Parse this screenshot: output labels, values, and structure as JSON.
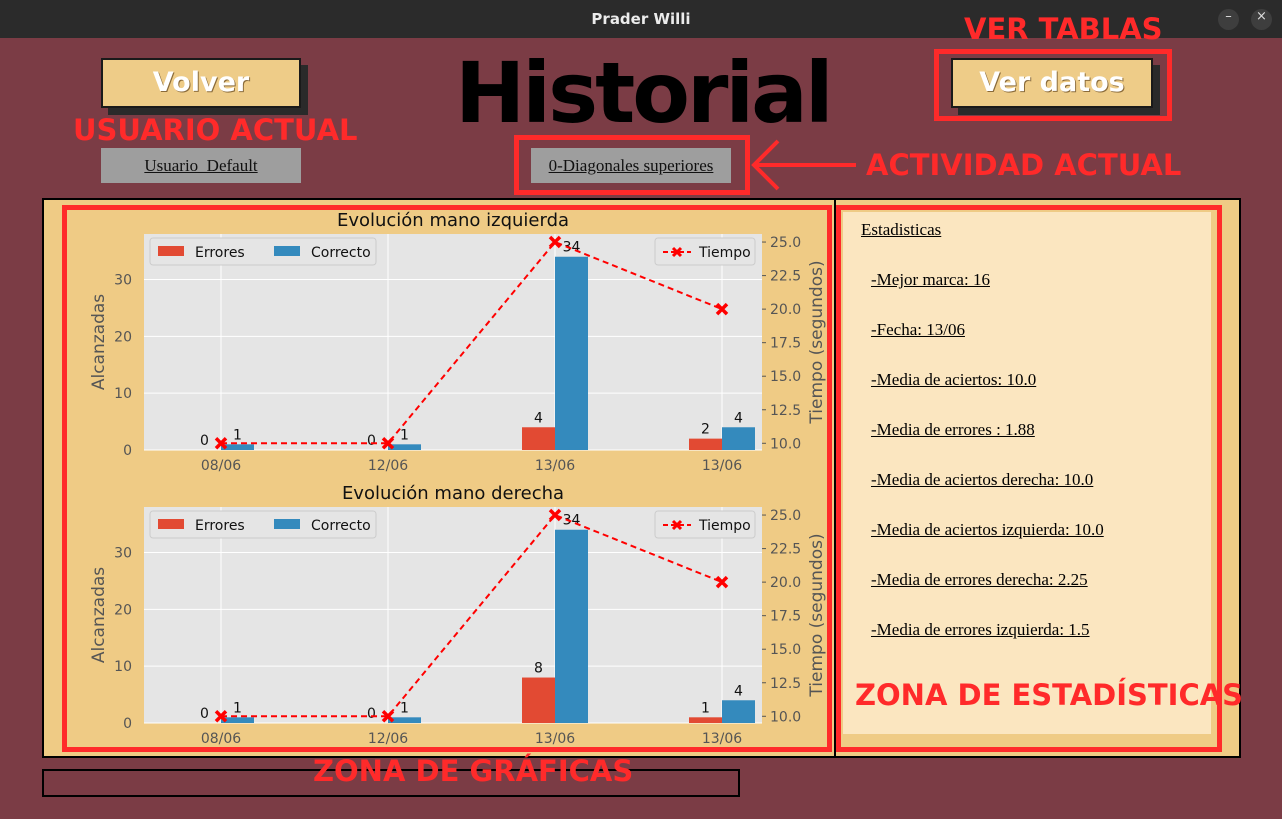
{
  "window": {
    "title": "Prader Willi"
  },
  "header": {
    "back_button": "Volver",
    "title": "Historial",
    "view_data_button": "Ver datos",
    "user": "Usuario_Default",
    "activity": "0-Diagonales superiores"
  },
  "annotations": {
    "ver_tablas": "VER TABLAS",
    "usuario_actual": "USUARIO ACTUAL",
    "actividad_actual": "ACTIVIDAD ACTUAL",
    "zona_graficas": "ZONA DE GRÁFICAS",
    "zona_estadisticas": "ZONA DE ESTADÍSTICAS"
  },
  "stats": {
    "title": "Estadisticas",
    "lines": [
      "-Mejor marca:  16",
      "-Fecha:  13/06",
      "-Media de aciertos:  10.0",
      "-Media de errores :  1.88",
      "-Media de aciertos derecha:  10.0",
      "-Media de aciertos izquierda:  10.0",
      "-Media de errores derecha:  2.25",
      "-Media de errores izquierda:  1.5"
    ]
  },
  "colors": {
    "background": "#7b3c45",
    "panel": "#efcb85",
    "stats_panel": "#fbe6c0",
    "button": "#eecc88",
    "annotation": "#ff2a2a",
    "errores": "#e24a33",
    "correcto": "#348abd",
    "tiempo": "#ff0000"
  },
  "chart_data": [
    {
      "type": "bar",
      "title": "Evolución mano izquierda",
      "categories": [
        "08/06",
        "12/06",
        "13/06",
        "13/06"
      ],
      "ylabel": "Alcanzadas",
      "y2label": "Tiempo (segundos)",
      "ylim": [
        0,
        38
      ],
      "y2lim": [
        9.5,
        25.6
      ],
      "yticks": [
        0,
        10,
        20,
        30
      ],
      "y2ticks": [
        10.0,
        12.5,
        15.0,
        17.5,
        20.0,
        22.5,
        25.0
      ],
      "y2ticklabels": [
        "10.0",
        "12.5",
        "15.0",
        "17.5",
        "20.0",
        "22.5",
        "25.0"
      ],
      "series": [
        {
          "name": "Errores",
          "values": [
            0,
            0,
            4,
            2
          ]
        },
        {
          "name": "Correcto",
          "values": [
            1,
            1,
            34,
            4
          ]
        },
        {
          "name": "Tiempo",
          "kind": "line",
          "axis": "right",
          "values": [
            10,
            10,
            25,
            20
          ]
        }
      ],
      "legend": [
        "top-left",
        "top-right"
      ],
      "grid": true
    },
    {
      "type": "bar",
      "title": "Evolución mano derecha",
      "categories": [
        "08/06",
        "12/06",
        "13/06",
        "13/06"
      ],
      "ylabel": "Alcanzadas",
      "y2label": "Tiempo (segundos)",
      "ylim": [
        0,
        38
      ],
      "y2lim": [
        9.5,
        25.6
      ],
      "yticks": [
        0,
        10,
        20,
        30
      ],
      "y2ticks": [
        10.0,
        12.5,
        15.0,
        17.5,
        20.0,
        22.5,
        25.0
      ],
      "y2ticklabels": [
        "10.0",
        "12.5",
        "15.0",
        "17.5",
        "20.0",
        "22.5",
        "25.0"
      ],
      "series": [
        {
          "name": "Errores",
          "values": [
            0,
            0,
            8,
            1
          ]
        },
        {
          "name": "Correcto",
          "values": [
            1,
            1,
            34,
            4
          ]
        },
        {
          "name": "Tiempo",
          "kind": "line",
          "axis": "right",
          "values": [
            10,
            10,
            25,
            20
          ]
        }
      ],
      "legend": [
        "top-left",
        "top-right"
      ],
      "grid": true
    }
  ]
}
